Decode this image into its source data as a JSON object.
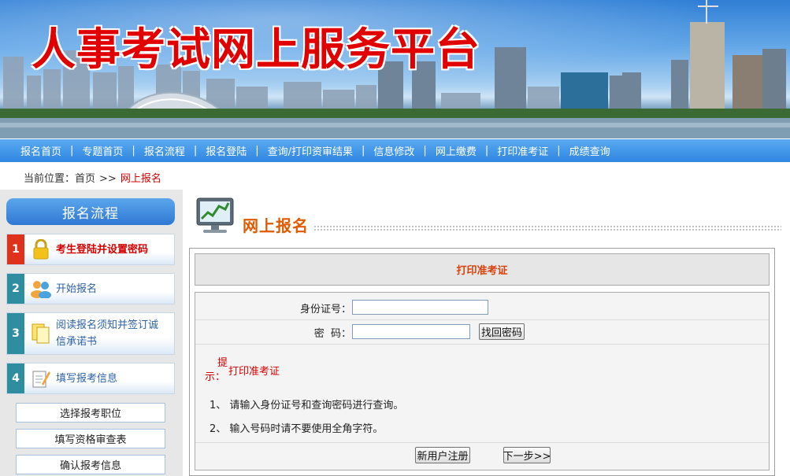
{
  "banner": {
    "title": "人事考试网上服务平台"
  },
  "nav": {
    "items": [
      "报名首页",
      "专题首页",
      "报名流程",
      "报名登陆",
      "查询/打印资审结果",
      "信息修改",
      "网上缴费",
      "打印准考证",
      "成绩查询"
    ],
    "separator": "|"
  },
  "breadcrumb": {
    "prefix": "当前位置：",
    "home": "首页",
    "sep": ">>",
    "current": "网上报名"
  },
  "sidebar": {
    "title": "报名流程",
    "steps": [
      {
        "num": "1",
        "label": "考生登陆并设置密码",
        "icon": "lock-icon"
      },
      {
        "num": "2",
        "label": "开始报名",
        "icon": "users-icon"
      },
      {
        "num": "3",
        "label_line1": "阅读报名须知并签订诚",
        "label_line2": "信承诺书",
        "icon": "documents-icon"
      },
      {
        "num": "4",
        "label": "填写报考信息",
        "icon": "notepad-icon"
      }
    ],
    "sub_items": [
      "选择报考职位",
      "填写资格审查表",
      "确认报考信息"
    ]
  },
  "content": {
    "section_title": "网上报名",
    "panel_title": "打印准考证",
    "form": {
      "id_label": "身份证号：",
      "id_value": "",
      "pwd_label": "密  码：",
      "pwd_value": "",
      "forgot_button": "找回密码"
    },
    "tip": {
      "label_top": "提",
      "label_bottom": "示：",
      "heading": "打印准考证"
    },
    "notes": [
      "1、 请输入身份证号和查询密码进行查询。",
      "2、 输入号码时请不要使用全角字符。"
    ],
    "register_button": "新用户注册",
    "next_button": "下一步>>"
  },
  "colors": {
    "nav": "#2f86e0",
    "active_step": "#e0321a",
    "accent_red": "#d40000",
    "title_orange": "#e05a00"
  }
}
